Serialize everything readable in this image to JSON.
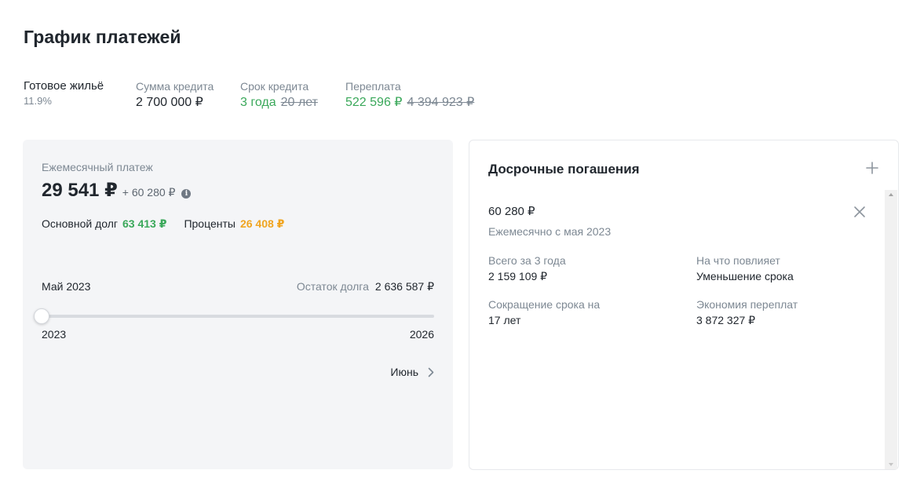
{
  "page": {
    "title": "График платежей"
  },
  "summary": {
    "product_name": "Готовое жильё",
    "product_rate": "11.9%",
    "amount_label": "Сумма кредита",
    "amount_value": "2 700 000 ₽",
    "term_label": "Срок кредита",
    "term_new": "3 года",
    "term_old": "20 лет",
    "overpay_label": "Переплата",
    "overpay_new": "522 596 ₽",
    "overpay_old": "4 394 923 ₽"
  },
  "payment": {
    "label": "Ежемесячный платеж",
    "amount": "29 541 ₽",
    "extra": "+ 60 280 ₽",
    "principal_label": "Основной долг",
    "principal_value": "63 413 ₽",
    "interest_label": "Проценты",
    "interest_value": "26 408 ₽",
    "month": "Май 2023",
    "remaining_label": "Остаток долга",
    "remaining_value": "2 636 587 ₽",
    "slider_min": "2023",
    "slider_max": "2026",
    "slider_position": 0,
    "next_label": "Июнь"
  },
  "prepayments": {
    "title": "Досрочные погашения",
    "item": {
      "amount": "60 280 ₽",
      "schedule": "Ежемесячно с мая 2023",
      "total_label": "Всего за 3 года",
      "total_value": "2 159 109 ₽",
      "effect_label": "На что повлияет",
      "effect_value": "Уменьшение срока",
      "term_cut_label": "Сокращение срока на",
      "term_cut_value": "17 лет",
      "savings_label": "Экономия переплат",
      "savings_value": "3 872 327 ₽"
    }
  },
  "icons": {
    "info": "info-icon",
    "chevron": "chevron-right-icon",
    "plus": "plus-icon",
    "close": "close-icon"
  },
  "colors": {
    "green": "#3aa85a",
    "orange": "#f0a520",
    "muted": "#7d8893",
    "text": "#21272e",
    "card_bg": "#f4f5f7"
  }
}
